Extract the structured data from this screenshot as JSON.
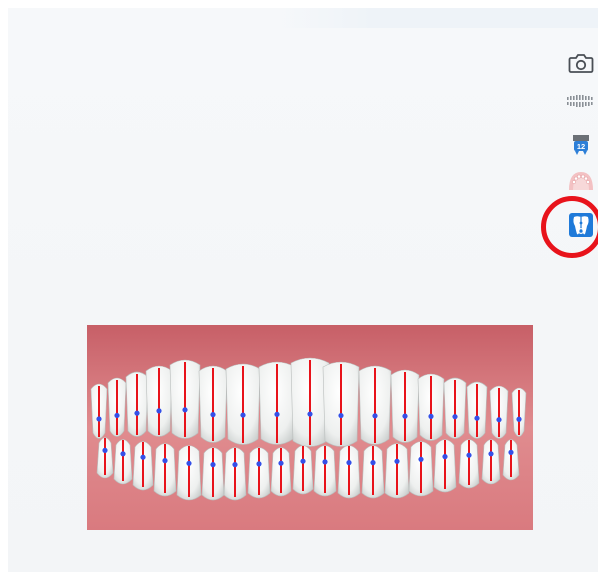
{
  "toolbar": {
    "tools": [
      {
        "icon": "camera-icon"
      },
      {
        "icon": "dental-arch-strip-icon"
      },
      {
        "icon": "tooth-numbering-icon",
        "label": "12"
      },
      {
        "icon": "gingiva-icon"
      },
      {
        "icon": "tooth-axis-icon",
        "active": true
      }
    ]
  },
  "annotation": {
    "color": "#e8131b"
  },
  "model": {
    "gingiva_color": "#d9797e",
    "axis_line_color": "#e8131b",
    "axis_point_color": "#3450e8"
  }
}
